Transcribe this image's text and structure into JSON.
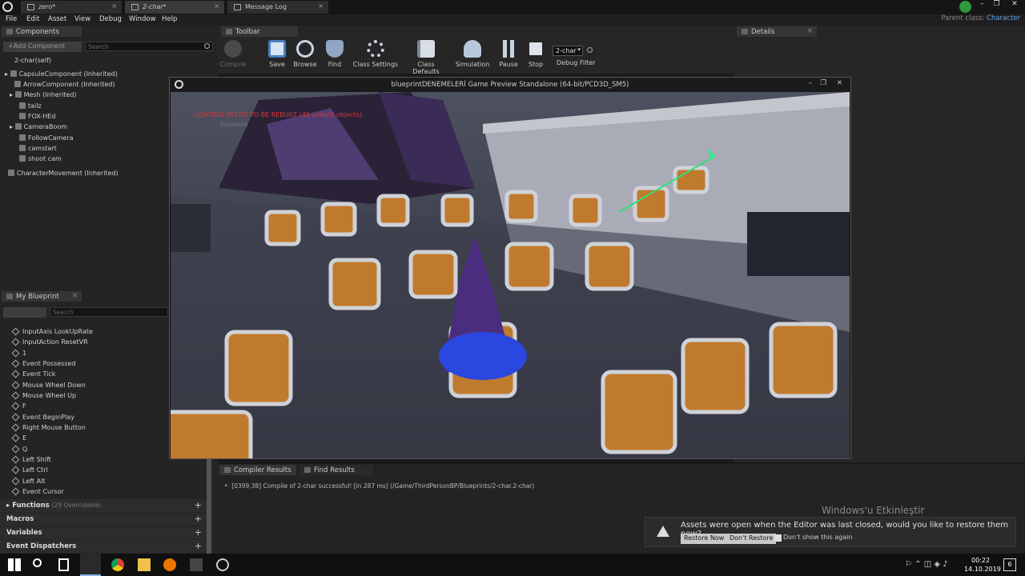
{
  "titlebar": {
    "tabs": [
      {
        "label": "zero*"
      },
      {
        "label": "2-char*"
      },
      {
        "label": "Message Log"
      }
    ],
    "parent_class_label": "Parent class:",
    "parent_class_value": "Character"
  },
  "menu": [
    "File",
    "Edit",
    "Asset",
    "View",
    "Debug",
    "Window",
    "Help"
  ],
  "components": {
    "tab_label": "Components",
    "add_button": "+Add Component",
    "search_placeholder": "Search",
    "self_item": "2-char(self)",
    "tree": [
      "CapsuleComponent (Inherited)",
      "ArrowComponent (Inherited)",
      "Mesh (Inherited)",
      "tailz",
      "FOX-HEd",
      "CameraBoom",
      "FollowCamera",
      "camstart",
      "shoot cam",
      "CharacterMovement (Inherited)"
    ]
  },
  "my_blueprint": {
    "tab_label": "My Blueprint",
    "search_placeholder": "Search",
    "items": [
      "InputAxis LookUpRate",
      "InputAction ResetVR",
      "1",
      "Event Possessed",
      "Event Tick",
      "Mouse Wheel Down",
      "Mouse Wheel Up",
      "F",
      "Event BeginPlay",
      "Right Mouse Button",
      "E",
      "Q",
      "Left Shift",
      "Left Ctrl",
      "Left Alt",
      "Event Cursor"
    ],
    "categories": {
      "functions": "Functions",
      "functions_count": "(29 Overridable)",
      "macros": "Macros",
      "variables": "Variables",
      "dispatchers": "Event Dispatchers"
    }
  },
  "toolbar": {
    "tab_label": "Toolbar",
    "buttons": [
      {
        "label": "Compile",
        "icon": "compile-icon"
      },
      {
        "label": "Save",
        "icon": "save-icon"
      },
      {
        "label": "Browse",
        "icon": "browse-icon"
      },
      {
        "label": "Find",
        "icon": "find-icon"
      },
      {
        "label": "Class Settings",
        "icon": "gear-icon"
      },
      {
        "label": "Class Defaults",
        "icon": "defaults-icon"
      },
      {
        "label": "Simulation",
        "icon": "simulation-icon"
      },
      {
        "label": "Pause",
        "icon": "pause-icon"
      },
      {
        "label": "Stop",
        "icon": "stop-icon"
      }
    ],
    "debug_select_value": "2-char",
    "debug_filter_label": "Debug Filter"
  },
  "details": {
    "tab_label": "Details"
  },
  "game_window": {
    "title": "blueprintDENEMELERİ Game Preview Standalone (64-bit/PCD3D_SM5)",
    "warning": "LIGHTING NEEDS TO BE REBUILT (45 unbuilt objects)",
    "sub_warning": "DisableAll"
  },
  "compiler": {
    "tab_label": "Compiler Results",
    "find_tab_label": "Find Results",
    "message": "[0399,38] Compile of 2-char successful! [in 287 ms] (/Game/ThirdPersonBP/Blueprints/2-char.2-char)"
  },
  "watermark": "Windows'u Etkinleştir",
  "notification": {
    "message": "Assets were open when the Editor was last closed, would you like to restore them now?",
    "restore": "Restore Now",
    "dont_restore": "Don't Restore",
    "dont_show": "Don't show this again"
  },
  "taskbar": {
    "time": "00:22",
    "date": "14.10.2019",
    "notif_count": "6"
  },
  "colors": {
    "warning_red": "#e0343a",
    "accent_blue": "#5aa0e6",
    "panel_bg": "#242424"
  }
}
